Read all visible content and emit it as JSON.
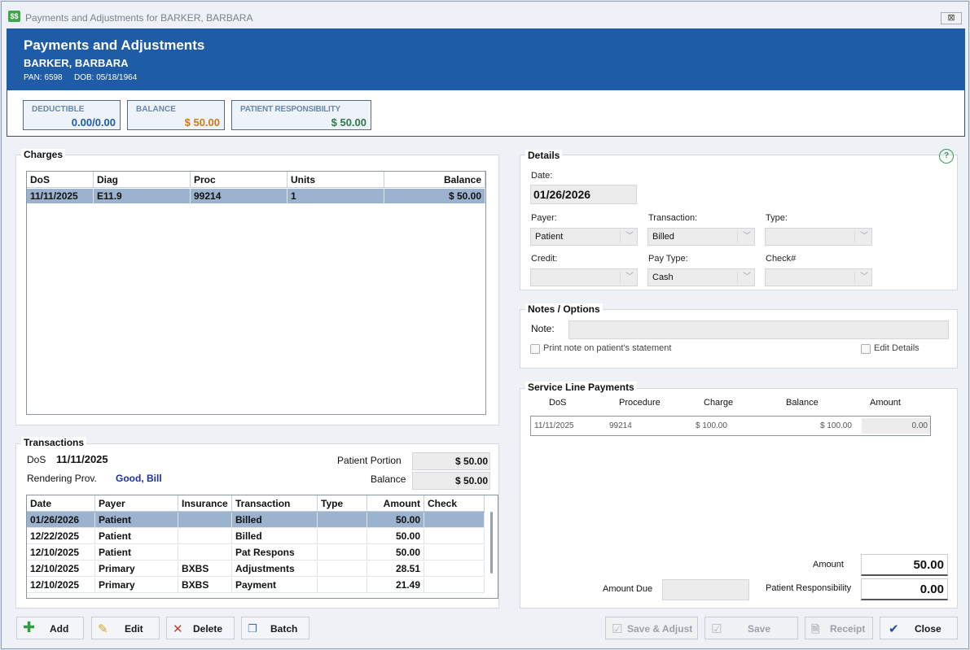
{
  "window": {
    "title": "Payments and Adjustments for BARKER, BARBARA",
    "icon_text": "$$",
    "close_glyph": "⊠"
  },
  "header": {
    "title": "Payments and Adjustments",
    "patient_name": "BARKER, BARBARA",
    "pan_label": "PAN: 6598",
    "dob_label": "DOB: 05/18/1964"
  },
  "summary": {
    "deductible": {
      "label": "DEDUCTIBLE",
      "value": "0.00/0.00",
      "color": "#1e5ca8"
    },
    "balance": {
      "label": "BALANCE",
      "value": "$ 50.00",
      "color": "#d07a13"
    },
    "patient_responsibility": {
      "label": "PATIENT RESPONSIBILITY",
      "value": "$ 50.00",
      "color": "#2d7a4a"
    }
  },
  "charges": {
    "title": "Charges",
    "columns": [
      "DoS",
      "Diag",
      "Proc",
      "Units",
      "Balance"
    ],
    "rows": [
      {
        "dos": "11/11/2025",
        "diag": "E11.9",
        "proc": "99214",
        "units": "1",
        "balance": "$ 50.00",
        "selected": true
      }
    ]
  },
  "transactions": {
    "title": "Transactions",
    "dos_label": "DoS",
    "dos_value": "11/11/2025",
    "rendering_label": "Rendering Prov.",
    "rendering_value": "Good, Bill",
    "patient_portion_label": "Patient Portion",
    "patient_portion_value": "$ 50.00",
    "balance_label": "Balance",
    "balance_value": "$ 50.00",
    "columns": [
      "Date",
      "Payer",
      "Insurance",
      "Transaction",
      "Type",
      "Amount",
      "Check"
    ],
    "rows": [
      {
        "date": "01/26/2026",
        "payer": "Patient",
        "insurance": "",
        "transaction": "Billed",
        "type": "",
        "amount": "50.00",
        "check": "",
        "selected": true
      },
      {
        "date": "12/22/2025",
        "payer": "Patient",
        "insurance": "",
        "transaction": "Billed",
        "type": "",
        "amount": "50.00",
        "check": "",
        "selected": false
      },
      {
        "date": "12/10/2025",
        "payer": "Patient",
        "insurance": "",
        "transaction": "Pat Respons",
        "type": "",
        "amount": "50.00",
        "check": "",
        "selected": false
      },
      {
        "date": "12/10/2025",
        "payer": "Primary",
        "insurance": "BXBS",
        "transaction": "Adjustments",
        "type": "",
        "amount": "28.51",
        "check": "",
        "selected": false
      },
      {
        "date": "12/10/2025",
        "payer": "Primary",
        "insurance": "BXBS",
        "transaction": "Payment",
        "type": "",
        "amount": "21.49",
        "check": "",
        "selected": false
      }
    ]
  },
  "details": {
    "title": "Details",
    "help_glyph": "?",
    "date_label": "Date:",
    "date_value": "01/26/2026",
    "payer_label": "Payer:",
    "payer_value": "Patient",
    "transaction_label": "Transaction:",
    "transaction_value": "Billed",
    "type_label": "Type:",
    "type_value": "",
    "credit_label": "Credit:",
    "credit_value": "",
    "paytype_label": "Pay Type:",
    "paytype_value": "Cash",
    "check_label": "Check#",
    "check_value": ""
  },
  "notes": {
    "title": "Notes / Options",
    "note_label": "Note:",
    "note_value": "",
    "print_note_label": "Print note on patient's statement",
    "edit_details_label": "Edit Details"
  },
  "service_line": {
    "title": "Service Line Payments",
    "columns": [
      "DoS",
      "Procedure",
      "Charge",
      "Balance",
      "Amount"
    ],
    "rows": [
      {
        "dos": "11/11/2025",
        "procedure": "99214",
        "charge": "$ 100.00",
        "balance": "$ 100.00",
        "amount": "0.00"
      }
    ],
    "amount_label": "Amount",
    "amount_value": "50.00",
    "amount_due_label": "Amount Due",
    "amount_due_value": "",
    "patient_resp_label": "Patient Responsibility",
    "patient_resp_value": "0.00"
  },
  "buttons": {
    "add": "Add",
    "edit": "Edit",
    "delete": "Delete",
    "batch": "Batch",
    "save_adjust": "Save & Adjust",
    "save": "Save",
    "receipt": "Receipt",
    "close": "Close"
  }
}
